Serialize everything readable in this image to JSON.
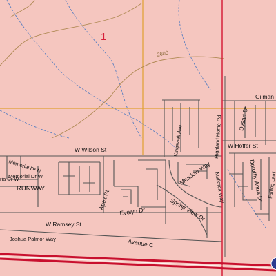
{
  "map": {
    "section_number": "1",
    "contour_label": "2600",
    "colors": {
      "land": "#f5c6bf",
      "grid": "#e0a030",
      "street": "#555555",
      "contour": "#b08a55",
      "drainage": "#5a7fc0",
      "county_line": "#d6203a",
      "highway": "#c8102e",
      "highway_shield": "#2b3a8f"
    },
    "labels": {
      "gilman": "Gilman",
      "w_wilson_st": "W Wilson St",
      "w_hoffer_st": "W Hoffer St",
      "memorial_dr_n": "Memorial Dr N",
      "memorial_dr_w": "Memorial Dr W",
      "ia_dr": "ria Dr W",
      "runway": "RUNWAY",
      "apex_st": "Apex St",
      "evelyn_dr": "Evelyn Dr",
      "w_ramsey_st": "W Ramsey St",
      "joshua_palmor_way": "Joshua Palmor Way",
      "avenue_c": "Avenue C",
      "kingswell_ave": "Kingswell Ave",
      "meadow_way": "Meadow Way",
      "spring_view_dr": "Spring View Dr",
      "highland_home_rd": "Highland Home Rd",
      "majorca_way": "Mallorca Way",
      "dysart_dr": "Dysart Dr",
      "dorothy_anna_dr": "Dorothy Anna Dr",
      "falling_leaf": "Falling Leaf"
    }
  }
}
